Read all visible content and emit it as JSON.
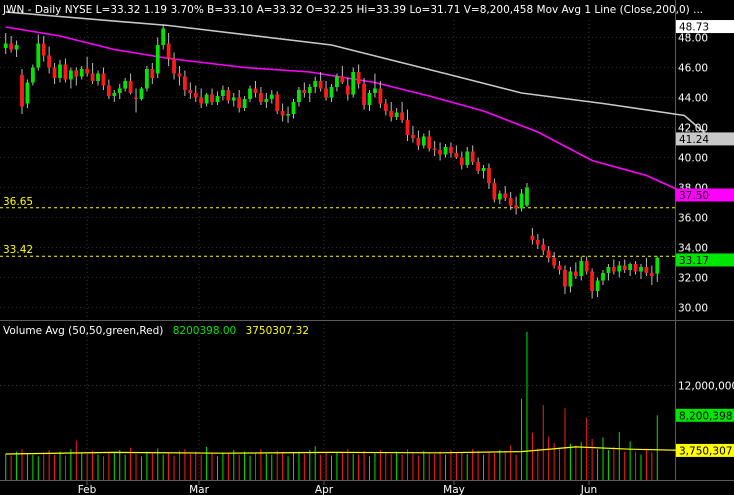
{
  "header": {
    "symbol": "JWN",
    "interval": "Daily",
    "exchange": "NYSE",
    "last": "L=33.32",
    "change": "1.19",
    "change_pct": "3.70%",
    "bid": "B=33.10",
    "ask": "A=33.32",
    "open": "O=32.25",
    "high": "Hi=33.39",
    "low": "Lo=31.71",
    "volume": "V=8,200,458",
    "indicator": "Mov Avg 1 Line (Close,200,0)",
    "ellipsis": "..."
  },
  "volume_header": {
    "label": "Volume Avg (50,50,green,Red)",
    "value": "8200398.00",
    "avg": "3750307.32"
  },
  "colors": {
    "background": "#000000",
    "up": "#00e600",
    "down": "#ff1a1a",
    "ma50": "#ff00ff",
    "ma200": "#c8c8c8",
    "vol_avg": "#ffff00",
    "hline": "#ffff00",
    "text": "#ffffff",
    "grid": "#5a5a5a"
  },
  "price_axis": {
    "ticks": [
      "30.00",
      "32.00",
      "34.00",
      "36.00",
      "38.00",
      "40.00",
      "42.00",
      "44.00",
      "46.00",
      "48.00"
    ],
    "markers": [
      {
        "label": "48.73",
        "value": 48.73,
        "bg": "#ffffff",
        "fg": "#000000"
      },
      {
        "label": "41.24",
        "value": 41.24,
        "bg": "#c8c8c8",
        "fg": "#000000"
      },
      {
        "label": "37.50",
        "value": 37.5,
        "bg": "#ff00ff",
        "fg": "#000000"
      },
      {
        "label": "33.17",
        "value": 33.17,
        "bg": "#00e600",
        "fg": "#000000"
      }
    ]
  },
  "hlines": [
    {
      "label": "36.65",
      "value": 36.65
    },
    {
      "label": "33.42",
      "value": 33.42
    }
  ],
  "volume_axis": {
    "ticks": [
      "12,000,000"
    ],
    "markers": [
      {
        "label": "8,200,398",
        "value": 8200398,
        "bg": "#00e600",
        "fg": "#000000"
      },
      {
        "label": "3,750,307",
        "value": 3750307,
        "bg": "#ffff00",
        "fg": "#000000"
      }
    ]
  },
  "x_axis": {
    "months": [
      "Feb",
      "Mar",
      "Apr",
      "May",
      "Jun"
    ]
  },
  "chart_data": [
    {
      "type": "candlestick",
      "ylim": [
        29.0,
        50.0
      ],
      "candles": [
        [
          47.3,
          48.3,
          46.9,
          47.6
        ],
        [
          47.6,
          48.1,
          47.0,
          47.2
        ],
        [
          47.2,
          47.8,
          46.7,
          47.5
        ],
        [
          45.5,
          45.9,
          42.9,
          43.4
        ],
        [
          43.6,
          45.2,
          43.3,
          45.0
        ],
        [
          45.0,
          46.2,
          44.8,
          46.0
        ],
        [
          46.0,
          48.2,
          45.8,
          47.6
        ],
        [
          47.6,
          48.1,
          46.4,
          46.8
        ],
        [
          46.8,
          47.4,
          45.6,
          46.0
        ],
        [
          46.0,
          46.3,
          44.9,
          45.3
        ],
        [
          45.3,
          46.5,
          45.0,
          46.2
        ],
        [
          46.2,
          46.6,
          45.0,
          45.2
        ],
        [
          45.2,
          46.0,
          44.6,
          45.8
        ],
        [
          45.8,
          46.0,
          44.8,
          45.4
        ],
        [
          45.4,
          46.1,
          45.2,
          45.9
        ],
        [
          45.9,
          46.7,
          45.4,
          45.6
        ],
        [
          45.6,
          46.3,
          44.9,
          45.1
        ],
        [
          45.1,
          45.8,
          44.8,
          45.6
        ],
        [
          45.6,
          46.0,
          44.5,
          44.8
        ],
        [
          44.8,
          45.2,
          43.9,
          44.1
        ],
        [
          44.1,
          44.5,
          43.7,
          44.3
        ],
        [
          44.3,
          44.9,
          43.9,
          44.6
        ],
        [
          44.6,
          45.3,
          44.4,
          45.1
        ],
        [
          45.1,
          45.6,
          44.2,
          44.3
        ],
        [
          44.0,
          44.6,
          43.0,
          43.9
        ],
        [
          43.9,
          44.7,
          43.8,
          44.6
        ],
        [
          44.6,
          46.1,
          44.4,
          45.9
        ],
        [
          45.9,
          46.3,
          44.9,
          45.3
        ],
        [
          45.6,
          48.0,
          45.3,
          47.5
        ],
        [
          47.5,
          48.9,
          47.2,
          48.6
        ],
        [
          47.6,
          48.3,
          46.1,
          46.6
        ],
        [
          46.6,
          47.0,
          45.2,
          45.6
        ],
        [
          45.6,
          46.1,
          44.8,
          45.4
        ],
        [
          45.4,
          45.8,
          44.1,
          44.5
        ],
        [
          44.5,
          45.0,
          43.9,
          44.3
        ],
        [
          44.3,
          44.8,
          43.7,
          44.0
        ],
        [
          44.0,
          44.6,
          43.3,
          43.6
        ],
        [
          43.6,
          44.3,
          43.4,
          44.2
        ],
        [
          44.2,
          44.6,
          43.5,
          43.7
        ],
        [
          43.7,
          44.4,
          43.5,
          44.1
        ],
        [
          44.1,
          44.8,
          43.8,
          44.5
        ],
        [
          44.5,
          44.7,
          43.6,
          43.8
        ],
        [
          43.8,
          44.3,
          43.4,
          44.0
        ],
        [
          44.0,
          44.5,
          43.0,
          43.3
        ],
        [
          43.3,
          44.1,
          43.1,
          43.9
        ],
        [
          43.9,
          44.8,
          43.7,
          44.6
        ],
        [
          44.6,
          45.1,
          44.0,
          44.3
        ],
        [
          44.3,
          44.7,
          43.5,
          43.7
        ],
        [
          43.7,
          44.3,
          43.3,
          43.9
        ],
        [
          43.9,
          44.5,
          43.6,
          44.2
        ],
        [
          44.2,
          44.4,
          42.9,
          43.1
        ],
        [
          43.1,
          43.6,
          42.4,
          42.8
        ],
        [
          42.8,
          43.4,
          42.3,
          42.9
        ],
        [
          42.9,
          43.9,
          42.6,
          43.7
        ],
        [
          43.7,
          44.7,
          43.4,
          44.5
        ],
        [
          44.5,
          45.0,
          44.0,
          44.3
        ],
        [
          44.3,
          44.9,
          43.7,
          44.7
        ],
        [
          44.7,
          45.4,
          44.3,
          45.1
        ],
        [
          45.1,
          45.7,
          44.4,
          44.6
        ],
        [
          44.6,
          45.1,
          43.8,
          44.0
        ],
        [
          44.0,
          44.9,
          43.7,
          44.7
        ],
        [
          44.7,
          45.6,
          44.4,
          45.4
        ],
        [
          45.4,
          46.1,
          44.9,
          45.0
        ],
        [
          44.8,
          45.3,
          43.8,
          44.2
        ],
        [
          44.2,
          46.0,
          44.0,
          45.7
        ],
        [
          45.7,
          46.2,
          44.6,
          44.9
        ],
        [
          44.9,
          45.3,
          43.2,
          43.5
        ],
        [
          43.5,
          44.5,
          43.1,
          44.3
        ],
        [
          44.3,
          45.6,
          44.0,
          44.6
        ],
        [
          44.6,
          45.1,
          43.3,
          43.6
        ],
        [
          43.6,
          43.9,
          42.8,
          43.1
        ],
        [
          43.1,
          43.7,
          42.4,
          42.7
        ],
        [
          42.7,
          43.3,
          42.5,
          43.0
        ],
        [
          43.0,
          43.7,
          42.3,
          42.5
        ],
        [
          42.5,
          43.2,
          41.1,
          41.5
        ],
        [
          41.5,
          42.1,
          41.0,
          41.3
        ],
        [
          41.3,
          41.8,
          40.5,
          40.8
        ],
        [
          40.8,
          41.6,
          40.6,
          41.4
        ],
        [
          41.4,
          41.8,
          40.4,
          40.6
        ],
        [
          40.6,
          41.1,
          40.1,
          40.5
        ],
        [
          40.5,
          41.0,
          39.8,
          40.2
        ],
        [
          40.2,
          40.9,
          40.0,
          40.7
        ],
        [
          40.7,
          41.0,
          40.0,
          40.3
        ],
        [
          40.3,
          40.8,
          39.9,
          40.0
        ],
        [
          40.0,
          40.4,
          39.2,
          39.5
        ],
        [
          39.5,
          40.7,
          39.3,
          40.4
        ],
        [
          40.4,
          40.8,
          39.5,
          39.7
        ],
        [
          39.7,
          40.0,
          38.9,
          39.1
        ],
        [
          39.1,
          39.5,
          38.6,
          39.3
        ],
        [
          39.3,
          39.6,
          37.9,
          38.3
        ],
        [
          38.3,
          38.6,
          37.0,
          37.2
        ],
        [
          37.2,
          37.8,
          36.9,
          37.6
        ],
        [
          37.6,
          38.1,
          37.1,
          37.3
        ],
        [
          37.3,
          37.7,
          36.5,
          36.8
        ],
        [
          36.8,
          37.4,
          36.2,
          36.6
        ],
        [
          36.6,
          37.9,
          36.4,
          37.6
        ],
        [
          36.8,
          38.3,
          36.7,
          38.0
        ],
        [
          34.8,
          35.3,
          34.2,
          34.5
        ],
        [
          34.5,
          34.9,
          33.9,
          34.2
        ],
        [
          34.2,
          34.6,
          33.5,
          33.8
        ],
        [
          33.8,
          34.1,
          33.0,
          33.3
        ],
        [
          33.3,
          33.7,
          32.6,
          32.8
        ],
        [
          32.8,
          33.1,
          32.2,
          32.5
        ],
        [
          32.5,
          32.8,
          30.9,
          31.4
        ],
        [
          31.4,
          32.7,
          31.0,
          32.4
        ],
        [
          32.4,
          33.0,
          31.9,
          32.1
        ],
        [
          32.1,
          33.4,
          31.8,
          33.1
        ],
        [
          33.1,
          33.4,
          32.2,
          32.4
        ],
        [
          32.4,
          32.6,
          30.6,
          31.1
        ],
        [
          31.1,
          32.0,
          30.7,
          31.8
        ],
        [
          31.8,
          32.5,
          31.5,
          32.3
        ],
        [
          32.3,
          32.9,
          31.8,
          32.7
        ],
        [
          32.7,
          33.2,
          32.2,
          32.4
        ],
        [
          32.4,
          33.1,
          32.0,
          32.8
        ],
        [
          32.8,
          33.2,
          32.3,
          32.5
        ],
        [
          32.5,
          33.0,
          32.1,
          32.9
        ],
        [
          32.9,
          33.1,
          32.2,
          32.4
        ],
        [
          32.4,
          32.9,
          31.9,
          32.7
        ],
        [
          32.7,
          33.3,
          32.1,
          32.3
        ],
        [
          32.3,
          32.8,
          31.5,
          32.1
        ],
        [
          32.25,
          33.39,
          31.71,
          33.32
        ]
      ],
      "ma200": [
        [
          0,
          49.7
        ],
        [
          30,
          48.8
        ],
        [
          60,
          47.5
        ],
        [
          82,
          45.5
        ],
        [
          95,
          44.3
        ],
        [
          110,
          43.6
        ],
        [
          125,
          42.8
        ],
        [
          130,
          41.24
        ]
      ],
      "ma50": [
        [
          0,
          48.7
        ],
        [
          10,
          48.1
        ],
        [
          20,
          47.2
        ],
        [
          30,
          46.6
        ],
        [
          44,
          46.0
        ],
        [
          56,
          45.7
        ],
        [
          68,
          45.0
        ],
        [
          78,
          44.1
        ],
        [
          88,
          43.1
        ],
        [
          98,
          41.7
        ],
        [
          108,
          39.8
        ],
        [
          118,
          38.8
        ],
        [
          126,
          37.5
        ]
      ]
    },
    {
      "type": "bar",
      "ylim": [
        0,
        18000000
      ],
      "volumes": [
        3.3,
        3.1,
        3.6,
        3.9,
        3.4,
        3.2,
        3.0,
        3.5,
        3.8,
        3.2,
        3.6,
        3.1,
        3.9,
        5.0,
        3.4,
        3.3,
        3.7,
        3.2,
        3.0,
        3.5,
        3.4,
        3.8,
        3.2,
        4.1,
        3.3,
        3.0,
        3.6,
        3.4,
        4.0,
        3.2,
        3.5,
        3.1,
        3.7,
        3.9,
        3.3,
        3.6,
        3.2,
        4.2,
        3.4,
        3.0,
        3.5,
        3.3,
        3.8,
        3.2,
        3.6,
        3.1,
        3.4,
        3.9,
        3.3,
        3.2,
        3.7,
        3.5,
        3.0,
        3.4,
        3.6,
        3.3,
        3.8,
        4.3,
        3.2,
        3.5,
        3.1,
        3.6,
        3.4,
        3.9,
        3.3,
        3.2,
        3.7,
        3.0,
        3.4,
        3.8,
        3.5,
        3.3,
        3.6,
        3.2,
        3.9,
        3.4,
        3.1,
        3.7,
        3.5,
        3.3,
        3.6,
        3.2,
        3.8,
        3.4,
        3.5,
        3.3,
        3.9,
        3.7,
        3.2,
        3.6,
        3.4,
        3.8,
        3.5,
        4.4,
        3.2,
        10.3,
        18.8,
        6.0,
        4.0,
        9.5,
        5.5,
        4.7,
        4.1,
        9.1,
        4.6,
        4.4,
        4.8,
        7.9,
        5.2,
        3.9,
        5.4,
        3.8,
        4.2,
        6.1,
        3.6,
        4.9,
        3.6,
        3.2,
        4.0,
        3.5,
        8.2
      ],
      "vol_avg": [
        [
          0,
          3.3
        ],
        [
          20,
          3.5
        ],
        [
          40,
          3.4
        ],
        [
          60,
          3.5
        ],
        [
          80,
          3.45
        ],
        [
          95,
          3.6
        ],
        [
          105,
          4.2
        ],
        [
          115,
          3.9
        ],
        [
          125,
          3.75
        ]
      ]
    }
  ]
}
